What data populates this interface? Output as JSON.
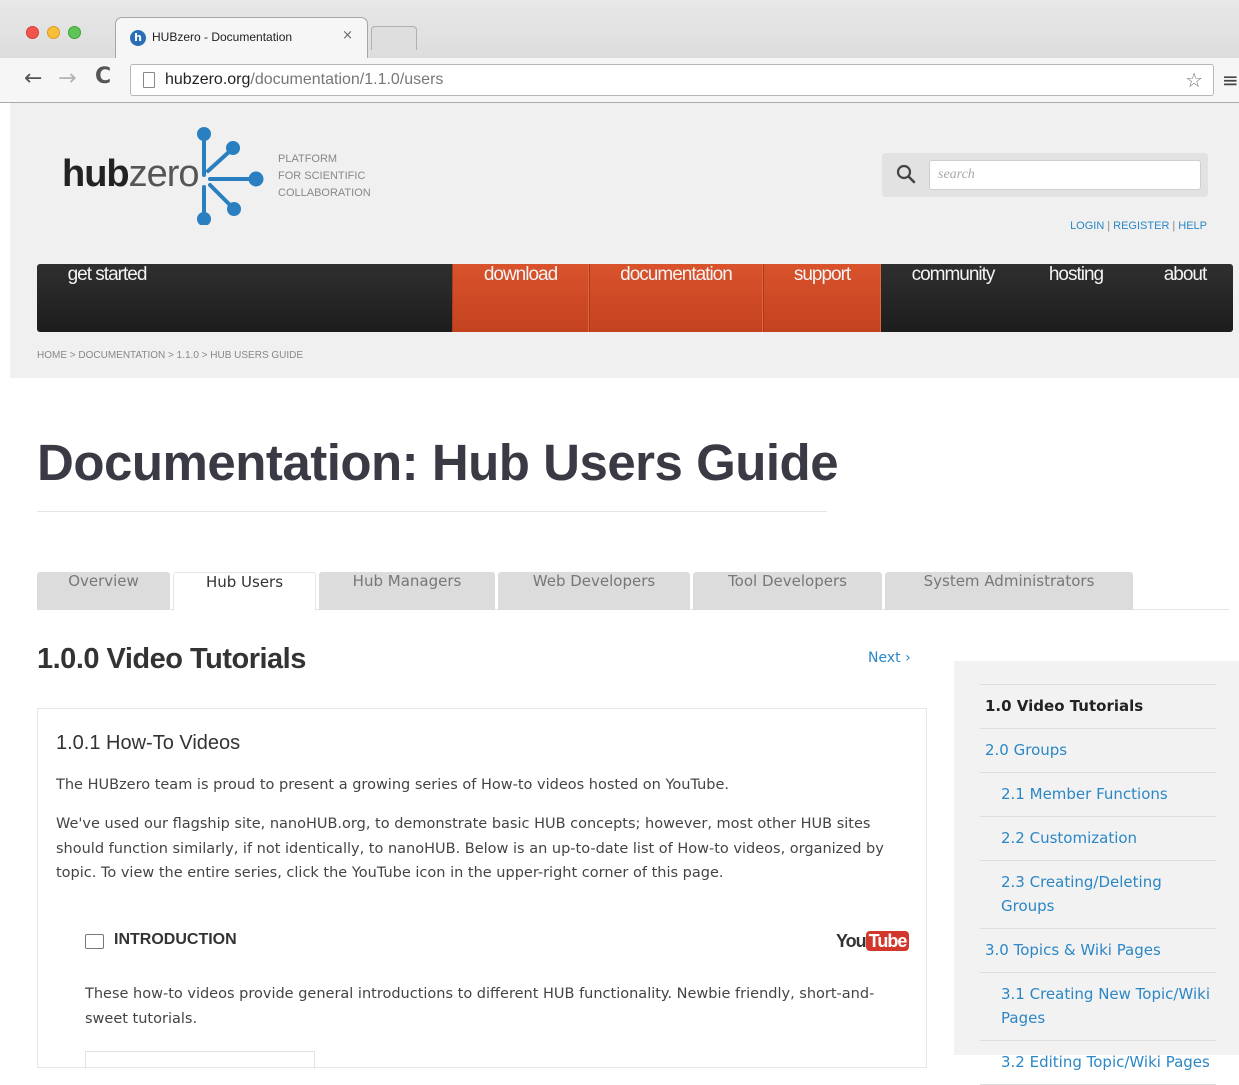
{
  "browser": {
    "tab_title": "HUBzero - Documentation",
    "tab_close": "×",
    "url_domain": "hubzero.org",
    "url_path": "/documentation/1.1.0/users",
    "back_glyph": "←",
    "forward_glyph": "→",
    "reload_glyph": "C",
    "star_glyph": "☆",
    "menu_glyph": "≡"
  },
  "header": {
    "logo_bold": "hub",
    "logo_light": "zero",
    "tagline": [
      "PLATFORM",
      "FOR SCIENTIFIC",
      "COLLABORATION"
    ],
    "search_placeholder": "search",
    "login": "LOGIN",
    "register": "REGISTER",
    "help": "HELP",
    "sep": "|"
  },
  "nav": {
    "get_started": "get started",
    "download": "download",
    "documentation": "documentation",
    "support": "support",
    "community": "community",
    "hosting": "hosting",
    "about": "about",
    "highlight_color": "#cf4a25"
  },
  "breadcrumb": "HOME > DOCUMENTATION > 1.1.0 > HUB USERS GUIDE",
  "page_title": "Documentation: Hub Users Guide",
  "doc_tabs": [
    "Overview",
    "Hub Users",
    "Hub Managers",
    "Web Developers",
    "Tool Developers",
    "System Administrators"
  ],
  "active_doc_tab": "Hub Users",
  "main": {
    "section_title": "1.0.0 Video Tutorials",
    "next_link": "Next ›",
    "sub_title": "1.0.1 How-To Videos",
    "p1": "The HUBzero team is proud to present a growing series of How-to videos hosted on YouTube.",
    "p2": "We've used our flagship site, nanoHUB.org, to demonstrate basic HUB concepts; however, most other HUB sites should function similarly, if not identically, to nanoHUB. Below is an up-to-date list of How-to videos, organized by topic. To view the entire series, click the YouTube icon in the upper-right corner of this page.",
    "intro_title": "INTRODUCTION",
    "youtube_you": "You",
    "youtube_tube": "Tube",
    "p3": "These how-to videos provide general introductions to different HUB functionality. Newbie friendly, short-and-sweet tutorials."
  },
  "toc": [
    {
      "label": "1.0 Video Tutorials",
      "level": 1,
      "current": true
    },
    {
      "label": "2.0 Groups",
      "level": 1
    },
    {
      "label": "2.1 Member Functions",
      "level": 2
    },
    {
      "label": "2.2 Customization",
      "level": 2
    },
    {
      "label": "2.3 Creating/Deleting Groups",
      "level": 2
    },
    {
      "label": "3.0 Topics & Wiki Pages",
      "level": 1
    },
    {
      "label": "3.1 Creating New Topic/Wiki Pages",
      "level": 2
    },
    {
      "label": "3.2 Editing Topic/Wiki Pages",
      "level": 2
    }
  ]
}
